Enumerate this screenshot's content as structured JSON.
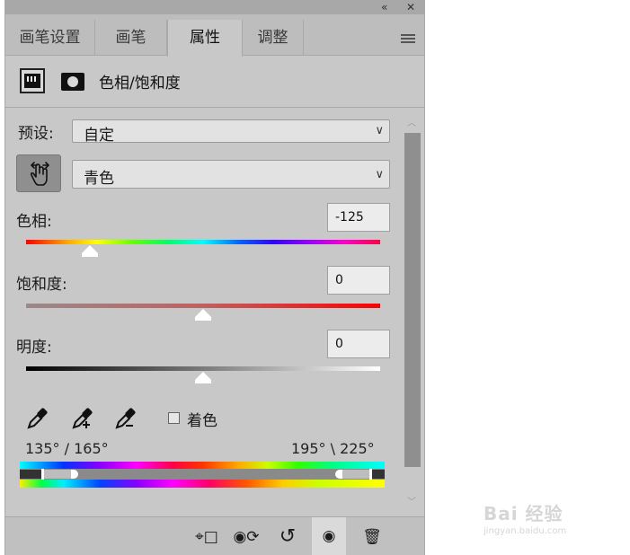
{
  "window": {
    "collapse_icon": "double-chevron-icon",
    "collapse_glyph": "«",
    "close_glyph": "✕"
  },
  "tabs": [
    {
      "label": "画笔设置"
    },
    {
      "label": "画笔"
    },
    {
      "label": "属性",
      "active": true
    },
    {
      "label": "调整"
    }
  ],
  "header": {
    "title": "色相/饱和度"
  },
  "preset": {
    "label": "预设:",
    "value": "自定"
  },
  "channel": {
    "value": "青色"
  },
  "hue": {
    "label": "色相:",
    "value": "-125",
    "slider_fraction": 0.18
  },
  "saturation": {
    "label": "饱和度:",
    "value": "0",
    "slider_fraction": 0.5
  },
  "lightness": {
    "label": "明度:",
    "value": "0",
    "slider_fraction": 0.5
  },
  "colorize": {
    "label": "着色",
    "checked": false
  },
  "range": {
    "left": "135° / 165°",
    "right": "195° \\ 225°"
  },
  "footer": {
    "buttons": [
      {
        "name": "clip-to-layer-icon",
        "glyph": "⌖□"
      },
      {
        "name": "view-previous-state-icon",
        "glyph": "◉⟳"
      },
      {
        "name": "reset-icon",
        "glyph": "↺"
      },
      {
        "name": "visibility-eye-icon",
        "glyph": "◉"
      },
      {
        "name": "trash-icon",
        "glyph": "🗑"
      }
    ]
  },
  "watermark": {
    "logo": "Bai 经验",
    "url": "jingyan.baidu.com"
  },
  "colors": {
    "panel_bg": "#c8c8c8",
    "active_tab": "#c8c8c8",
    "hand_button": "#8f8f8f"
  }
}
